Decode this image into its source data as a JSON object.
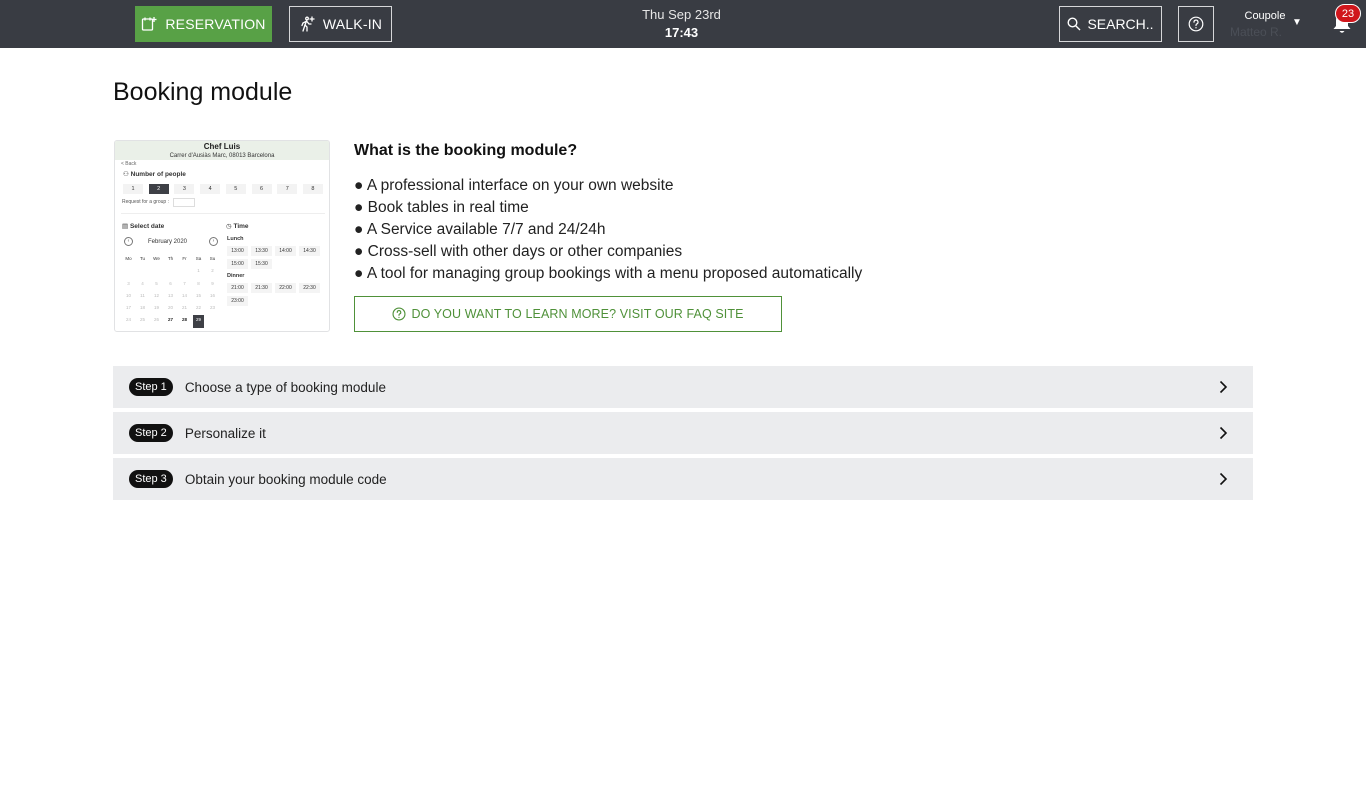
{
  "topbar": {
    "reservation_label": "RESERVATION",
    "walkin_label": "WALK-IN",
    "date": "Thu Sep 23rd",
    "time": "17:43",
    "search_label": "SEARCH..",
    "company": "Coupole",
    "user": "Matteo R.",
    "notifications": "23"
  },
  "page": {
    "title": "Booking module"
  },
  "preview": {
    "restaurant": "Chef Luis",
    "address": "Carrer d'Ausiàs Marc, 08013 Barcelona",
    "back": "< Back",
    "people_label": "Number of people",
    "people": [
      "1",
      "2",
      "3",
      "4",
      "5",
      "6",
      "7",
      "8"
    ],
    "group_request": "Request for a group :",
    "date_label": "Select date",
    "month": "February 2020",
    "weekdays": [
      "Mo",
      "Tu",
      "We",
      "Th",
      "Fr",
      "Sa",
      "Su"
    ],
    "time_label": "Time",
    "lunch_label": "Lunch",
    "lunch_slots": [
      "13:00",
      "13:30",
      "14:00",
      "14:30",
      "15:00",
      "15:30"
    ],
    "dinner_label": "Dinner",
    "dinner_slots": [
      "21:00",
      "21:30",
      "22:00",
      "22:30",
      "23:00"
    ]
  },
  "info": {
    "title": "What is the booking module?",
    "bullets": [
      "● A professional interface on your own website",
      "● Book tables in real time",
      "● A Service available 7/7 and 24/24h",
      "● Cross-sell with other days or other companies",
      "● A tool for managing group bookings with a menu proposed automatically"
    ],
    "faq_label": "DO YOU WANT TO LEARN MORE? VISIT OUR FAQ SITE"
  },
  "steps": [
    {
      "badge": "Step 1",
      "label": "Choose a type of booking module"
    },
    {
      "badge": "Step 2",
      "label": "Personalize it"
    },
    {
      "badge": "Step 3",
      "label": "Obtain your booking module code"
    }
  ],
  "colors": {
    "topbar": "#393c43",
    "primary_green": "#58a146",
    "accent_green": "#4f9139",
    "step_bg": "#ebecee",
    "badge_red": "#d0161c"
  },
  "icons": {
    "reservation": "calendar-plus-icon",
    "walkin": "walking-person-icon",
    "search": "search-icon",
    "help": "question-circle-icon",
    "notifications": "bell-icon",
    "step": "chevron-right-icon"
  }
}
